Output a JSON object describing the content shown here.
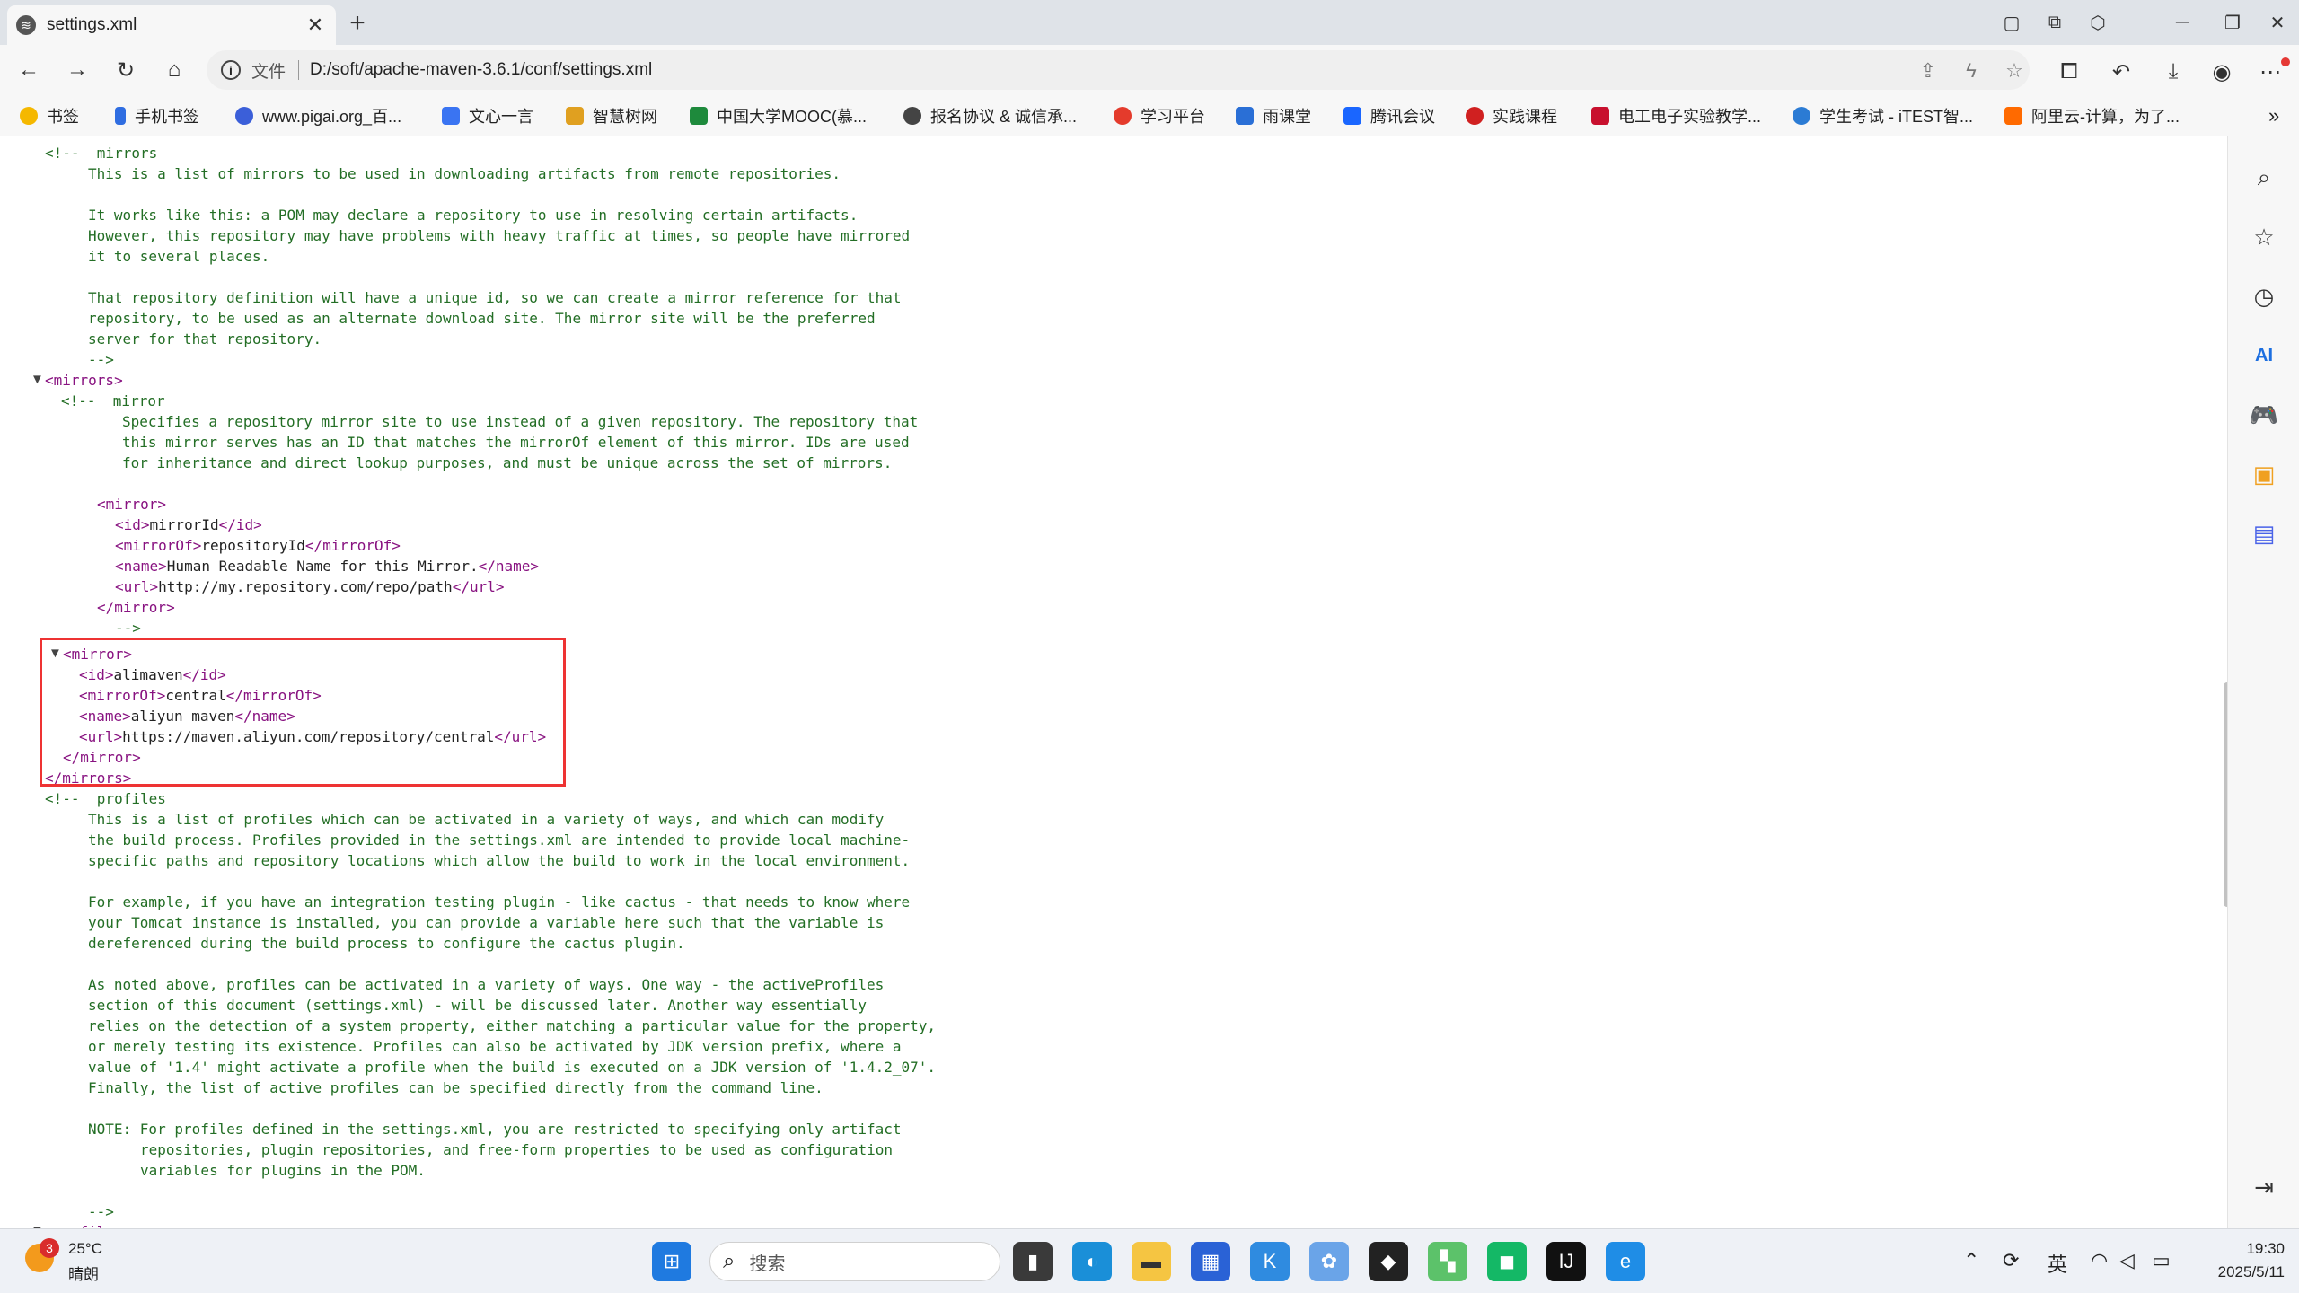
{
  "browser": {
    "tab_title": "settings.xml",
    "tab_close": "✕",
    "new_tab": "+",
    "address_label": "文件",
    "url": "D:/soft/apache-maven-3.6.1/conf/settings.xml",
    "bookmarks": [
      {
        "label": "书签",
        "color": "#f5b800"
      },
      {
        "label": "手机书签",
        "color": "#2f6de1"
      },
      {
        "label": "www.pigai.org_百...",
        "color": "#3b5fd9"
      },
      {
        "label": "文心一言",
        "color": "#3a74f2"
      },
      {
        "label": "智慧树网",
        "color": "#e0a020"
      },
      {
        "label": "中国大学MOOC(慕...",
        "color": "#1e8a3c"
      },
      {
        "label": "报名协议 & 诚信承...",
        "color": "#444444"
      },
      {
        "label": "学习平台",
        "color": "#e43b2c"
      },
      {
        "label": "雨课堂",
        "color": "#2a6fd6"
      },
      {
        "label": "腾讯会议",
        "color": "#1a66ff"
      },
      {
        "label": "实践课程",
        "color": "#d02020"
      },
      {
        "label": "电工电子实验教学...",
        "color": "#c8102e"
      },
      {
        "label": "学生考试 - iTEST智...",
        "color": "#2b7bd4"
      },
      {
        "label": "阿里云-计算，为了...",
        "color": "#ff6a00"
      }
    ],
    "more_bookmarks": "»"
  },
  "code": {
    "comment_open": "<!--",
    "comment_close": "-->",
    "mirrors_word": "mirrors",
    "mirror_word": "mirror",
    "profiles_word": "profiles",
    "c1": "This is a list of mirrors to be used in downloading artifacts from remote repositories.",
    "c2": "It works like this: a POM may declare a repository to use in resolving certain artifacts.",
    "c3": "However, this repository may have problems with heavy traffic at times, so people have mirrored",
    "c4": "it to several places.",
    "c5": "That repository definition will have a unique id, so we can create a mirror reference for that",
    "c6": "repository, to be used as an alternate download site. The mirror site will be the preferred",
    "c7": "server for that repository.",
    "m1": "Specifies a repository mirror site to use instead of a given repository. The repository that",
    "m2": "this mirror serves has an ID that matches the mirrorOf element of this mirror. IDs are used",
    "m3": "for inheritance and direct lookup purposes, and must be unique across the set of mirrors.",
    "t_mirrors_open": "<mirrors>",
    "t_mirrors_close": "</mirrors>",
    "t_mirror_open": "<mirror>",
    "t_mirror_close": "</mirror>",
    "t_id_open": "<id>",
    "t_id_close": "</id>",
    "t_mirrorof_open": "<mirrorOf>",
    "t_mirrorof_close": "</mirrorOf>",
    "t_name_open": "<name>",
    "t_name_close": "</name>",
    "t_url_open": "<url>",
    "t_url_close": "</url>",
    "ex_id": "mirrorId",
    "ex_of": "repositoryId",
    "ex_name": "Human Readable Name for this Mirror.",
    "ex_url": "http://my.repository.com/repo/path",
    "ali_id": "alimaven",
    "ali_of": "central",
    "ali_name": "aliyun maven",
    "ali_url": "https://maven.aliyun.com/repository/central",
    "p1": "This is a list of profiles which can be activated in a variety of ways, and which can modify",
    "p2": "the build process. Profiles provided in the settings.xml are intended to provide local machine-",
    "p3": "specific paths and repository locations which allow the build to work in the local environment.",
    "p4": "For example, if you have an integration testing plugin - like cactus - that needs to know where",
    "p5": "your Tomcat instance is installed, you can provide a variable here such that the variable is",
    "p6": "dereferenced during the build process to configure the cactus plugin.",
    "p7": "As noted above, profiles can be activated in a variety of ways. One way - the activeProfiles",
    "p8": "section of this document (settings.xml) - will be discussed later. Another way essentially",
    "p9": "relies on the detection of a system property, either matching a particular value for the property,",
    "p10": "or merely testing its existence. Profiles can also be activated by JDK version prefix, where a",
    "p11": "value of '1.4' might activate a profile when the build is executed on a JDK version of '1.4.2_07'.",
    "p12": "Finally, the list of active profiles can be specified directly from the command line.",
    "p13": "NOTE: For profiles defined in the settings.xml, you are restricted to specifying only artifact",
    "p14": "repositories, plugin repositories, and free-form properties to be used as configuration",
    "p15": "variables for plugins in the POM.",
    "t_profiles_partial": "<profiles>"
  },
  "taskbar": {
    "weather_temp": "25°C",
    "weather_desc": "晴朗",
    "weather_badge": "3",
    "search_placeholder": "搜索",
    "ime": "英",
    "time": "19:30",
    "date": "2025/5/11"
  },
  "colors": {
    "comment": "#236e25",
    "tag": "#881280",
    "highlight": "#ee3333"
  }
}
